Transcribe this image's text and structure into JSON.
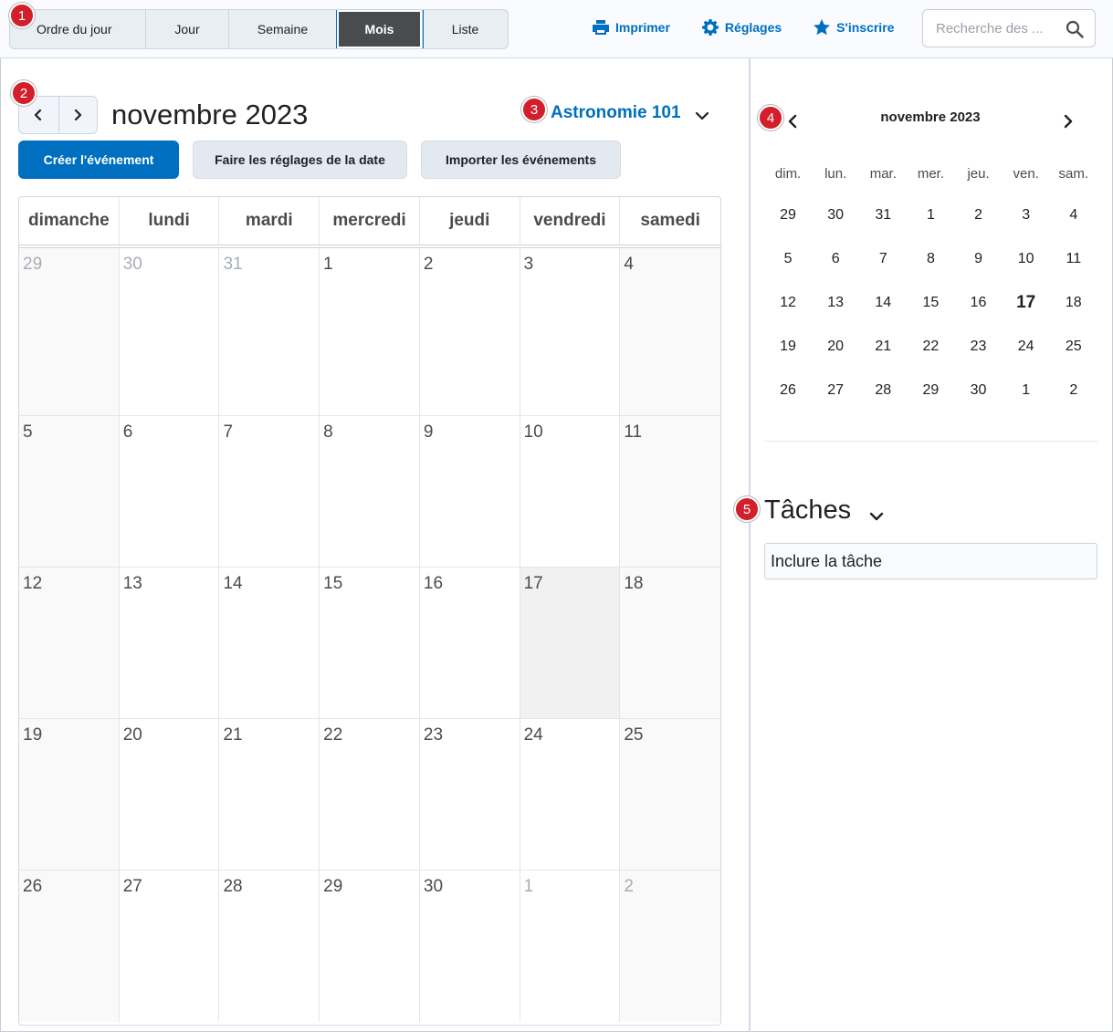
{
  "views": [
    {
      "label": "Ordre du jour",
      "active": false
    },
    {
      "label": "Jour",
      "active": false
    },
    {
      "label": "Semaine",
      "active": false
    },
    {
      "label": "Mois",
      "active": true
    },
    {
      "label": "Liste",
      "active": false
    }
  ],
  "actions": {
    "print": "Imprimer",
    "settings": "Réglages",
    "subscribe": "S'inscrire"
  },
  "search": {
    "placeholder": "Recherche des ..."
  },
  "calendar": {
    "month_title": "novembre 2023",
    "course": "Astronomie 101",
    "buttons": {
      "create": "Créer l'événement",
      "date_settings": "Faire les réglages de la date",
      "import": "Importer les événements"
    },
    "weekdays": [
      "dimanche",
      "lundi",
      "mardi",
      "mercredi",
      "jeudi",
      "vendredi",
      "samedi"
    ],
    "weeks": [
      [
        "29",
        "30",
        "31",
        "1",
        "2",
        "3",
        "4"
      ],
      [
        "5",
        "6",
        "7",
        "8",
        "9",
        "10",
        "11"
      ],
      [
        "12",
        "13",
        "14",
        "15",
        "16",
        "17",
        "18"
      ],
      [
        "19",
        "20",
        "21",
        "22",
        "23",
        "24",
        "25"
      ],
      [
        "26",
        "27",
        "28",
        "29",
        "30",
        "1",
        "2"
      ]
    ],
    "today": "17"
  },
  "mini_calendar": {
    "title": "novembre 2023",
    "weekdays": [
      "dim.",
      "lun.",
      "mar.",
      "mer.",
      "jeu.",
      "ven.",
      "sam."
    ],
    "weeks": [
      [
        "29",
        "30",
        "31",
        "1",
        "2",
        "3",
        "4"
      ],
      [
        "5",
        "6",
        "7",
        "8",
        "9",
        "10",
        "11"
      ],
      [
        "12",
        "13",
        "14",
        "15",
        "16",
        "17",
        "18"
      ],
      [
        "19",
        "20",
        "21",
        "22",
        "23",
        "24",
        "25"
      ],
      [
        "26",
        "27",
        "28",
        "29",
        "30",
        "1",
        "2"
      ]
    ]
  },
  "tasks": {
    "title": "Tâches",
    "input_placeholder": "Inclure la tâche"
  },
  "callouts": [
    "1",
    "2",
    "3",
    "4",
    "5"
  ],
  "colors": {
    "accent": "#006fbf",
    "active_tab": "#494c4e",
    "badge": "#d21f2b"
  }
}
